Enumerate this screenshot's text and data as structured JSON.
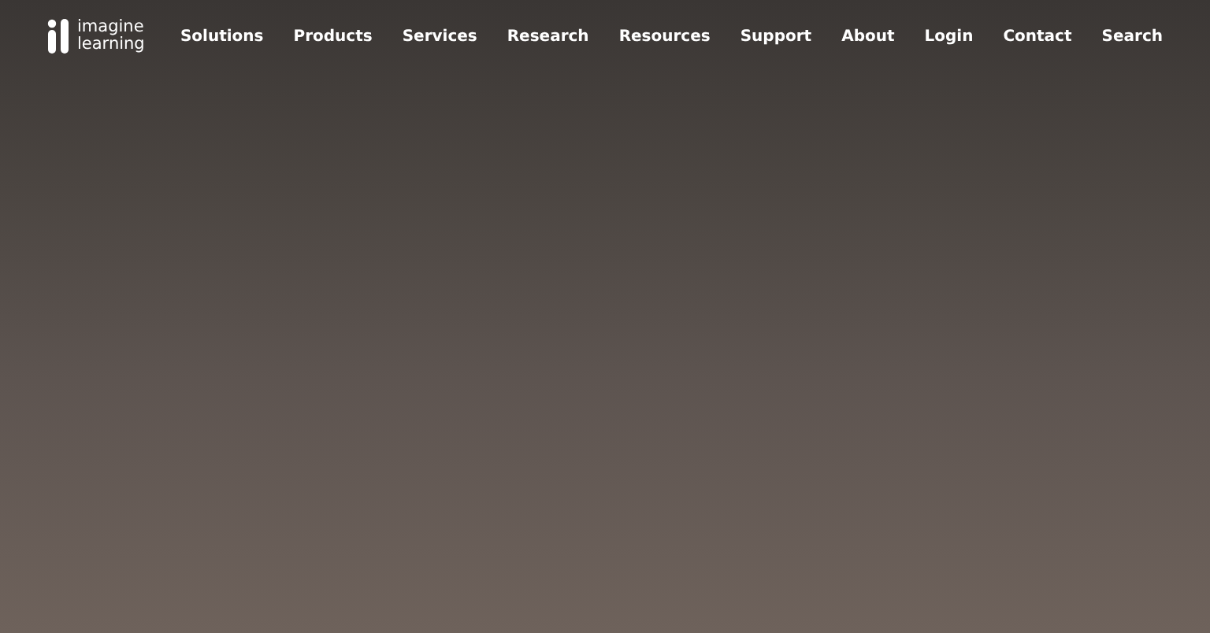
{
  "logo": {
    "line_1": "imagine",
    "line_2": "learning"
  },
  "nav": [
    "Solutions",
    "Products",
    "Services",
    "Research",
    "Resources",
    "Support",
    "About",
    "Login",
    "Contact",
    "Search"
  ]
}
